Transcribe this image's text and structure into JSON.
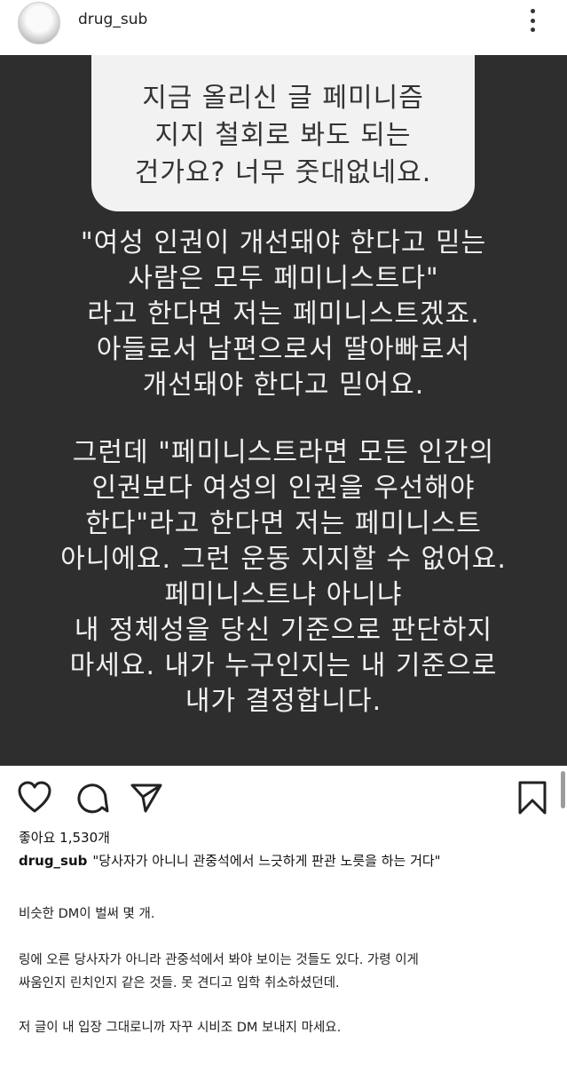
{
  "header": {
    "username": "drug_sub"
  },
  "question": {
    "lines": [
      "지금 올리신 글 페미니즘",
      "지지 철회로 봐도 되는",
      "건가요? 너무 줏대없네요."
    ]
  },
  "answer": {
    "paragraph1": [
      "\"여성 인권이 개선돼야 한다고 믿는",
      "사람은 모두 페미니스트다\"",
      "라고 한다면 저는 페미니스트겠죠.",
      "아들로서 남편으로서 딸아빠로서",
      "개선돼야 한다고 믿어요."
    ],
    "paragraph2": [
      "그런데 \"페미니스트라면 모든 인간의",
      "인권보다 여성의 인권을 우선해야",
      "한다\"라고 한다면 저는 페미니스트",
      "아니에요. 그런 운동 지지할 수 없어요.",
      "페미니스트냐 아니냐",
      "내 정체성을 당신 기준으로 판단하지",
      "마세요. 내가 누구인지는 내 기준으로",
      "내가 결정합니다."
    ]
  },
  "actions": {
    "like_icon": "heart-icon",
    "comment_icon": "comment-icon",
    "share_icon": "send-icon",
    "save_icon": "bookmark-icon"
  },
  "likes_text": "좋아요 1,530개",
  "caption": {
    "username": "drug_sub",
    "text": "\"당사자가 아니니 관중석에서 느긋하게 판관 노릇을 하는 거다\""
  },
  "body": {
    "p1": "비슷한 DM이 벌써 몇 개.",
    "p2_line1": "링에 오른 당사자가 아니라 관중석에서 봐야 보이는 것들도 있다. 가령 이게",
    "p2_line2": "싸움인지 린치인지 같은 것들. 못 견디고 입학 취소하셨던데.",
    "p3": "저 글이 내 입장 그대로니까 자꾸 시비조 DM 보내지 마세요."
  }
}
